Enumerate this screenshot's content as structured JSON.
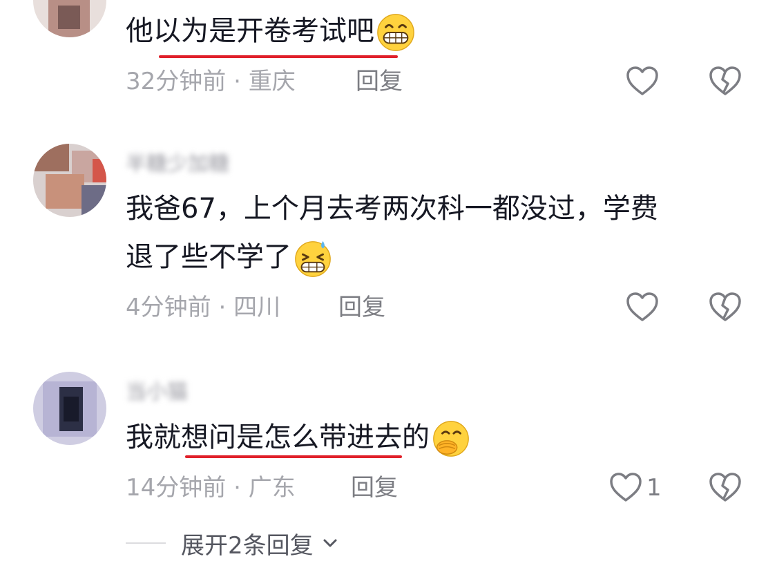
{
  "comments": [
    {
      "username": "",
      "text": "他以为是开卷考试吧",
      "emoji": "grinning-face-emoji",
      "time": "32分钟前",
      "location": "重庆",
      "reply_label": "回复",
      "likes": ""
    },
    {
      "username": "半糖少加糖",
      "text_line1": "我爸67，上个月去考两次科一都没过，学费",
      "text_line2": "退了些不学了",
      "emoji": "grinning-sweat-emoji",
      "time": "4分钟前",
      "location": "四川",
      "reply_label": "回复",
      "likes": ""
    },
    {
      "username": "当小猫",
      "text": "我就想问是怎么带进去的",
      "emoji": "face-with-hand-over-mouth-emoji",
      "time": "14分钟前",
      "location": "广东",
      "reply_label": "回复",
      "likes": "1"
    }
  ],
  "separator": " · ",
  "expand": {
    "label": "展开2条回复"
  },
  "colors": {
    "underline": "#e0202a",
    "text": "#161823",
    "meta": "#a5a6ac",
    "emoji": "#ffd23e"
  }
}
